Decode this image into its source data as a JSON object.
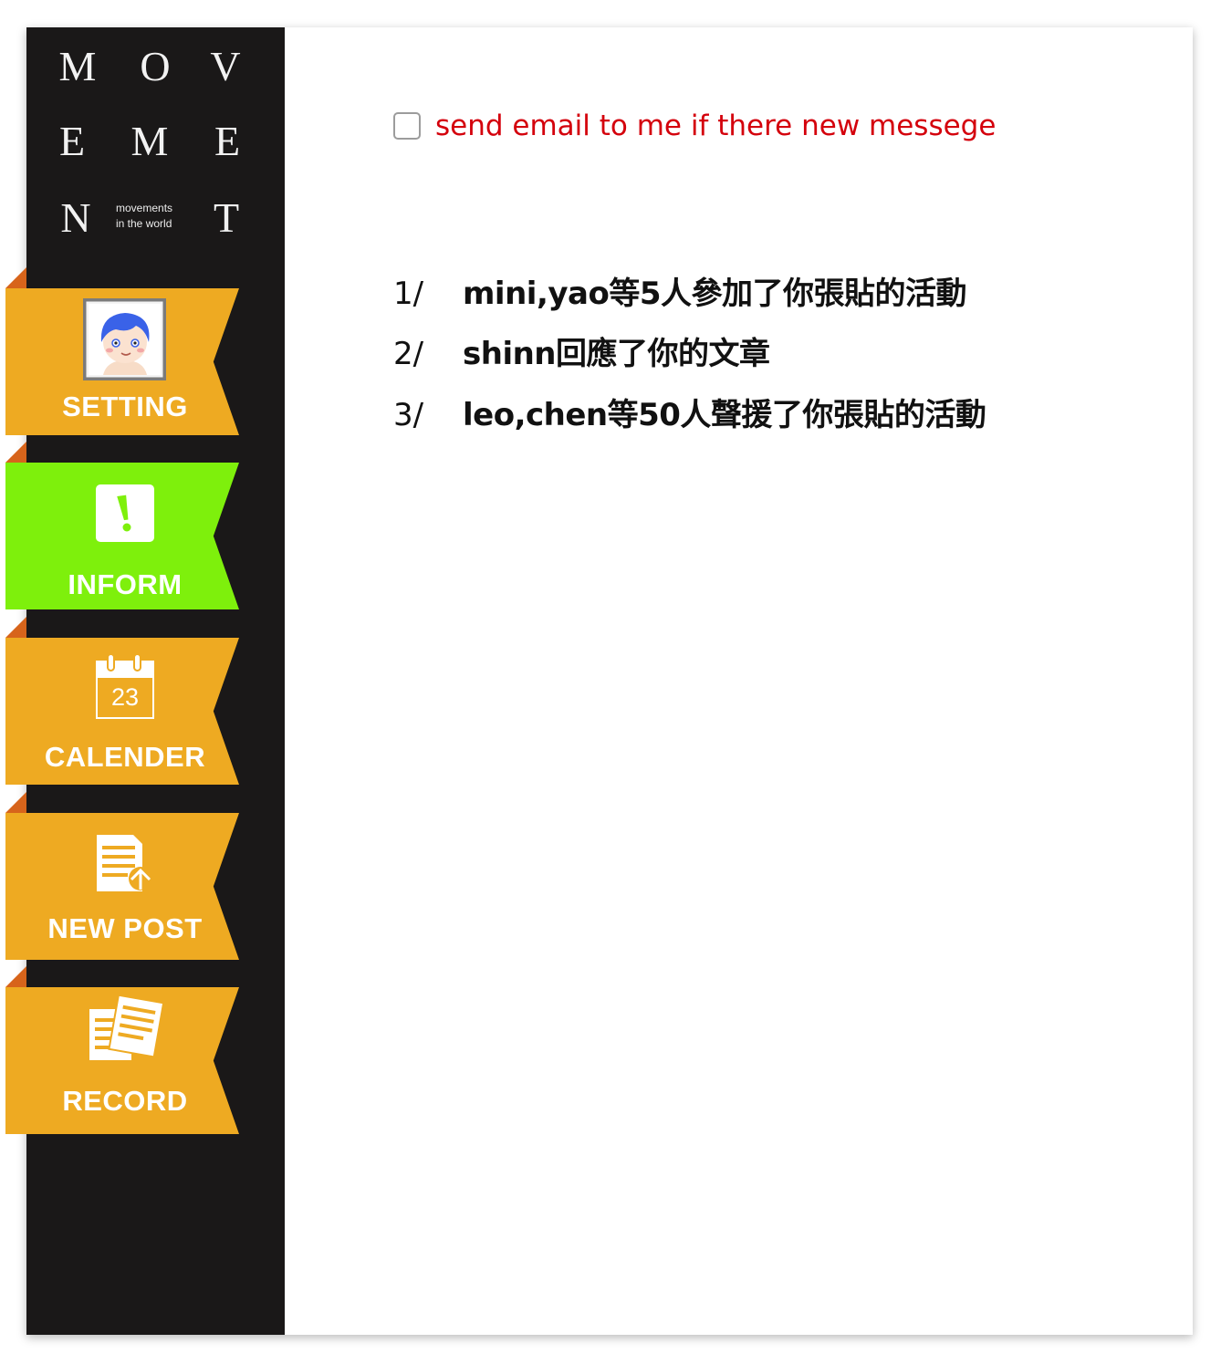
{
  "logo": {
    "letters": [
      "M",
      "O",
      "V",
      "E",
      "M",
      "E",
      "N",
      "T"
    ],
    "tagline": "movements\nin the world"
  },
  "nav": {
    "items": [
      {
        "label": "SETTING",
        "icon": "avatar-icon",
        "active": false
      },
      {
        "label": "INFORM",
        "icon": "exclamation-icon",
        "active": true
      },
      {
        "label": "CALENDER",
        "icon": "calendar-icon",
        "active": false,
        "icon_text": "23"
      },
      {
        "label": "NEW POST",
        "icon": "new-post-icon",
        "active": false
      },
      {
        "label": "RECORD",
        "icon": "record-icon",
        "active": false
      }
    ]
  },
  "email_option": {
    "label": "send email to me if there new messege",
    "checked": false
  },
  "messages": [
    {
      "num": "1/",
      "text": "mini,yao等5人參加了你張貼的活動"
    },
    {
      "num": "2/",
      "text": "shinn回應了你的文章"
    },
    {
      "num": "3/",
      "text": "leo,chen等50人聲援了你張貼的活動"
    }
  ],
  "colors": {
    "sidebar": "#1a1818",
    "tab": "#eeaa22",
    "tab_active": "#7ef00c",
    "tab_fold": "#d7641b",
    "email_text": "#d4000c",
    "message_text": "#111111"
  }
}
